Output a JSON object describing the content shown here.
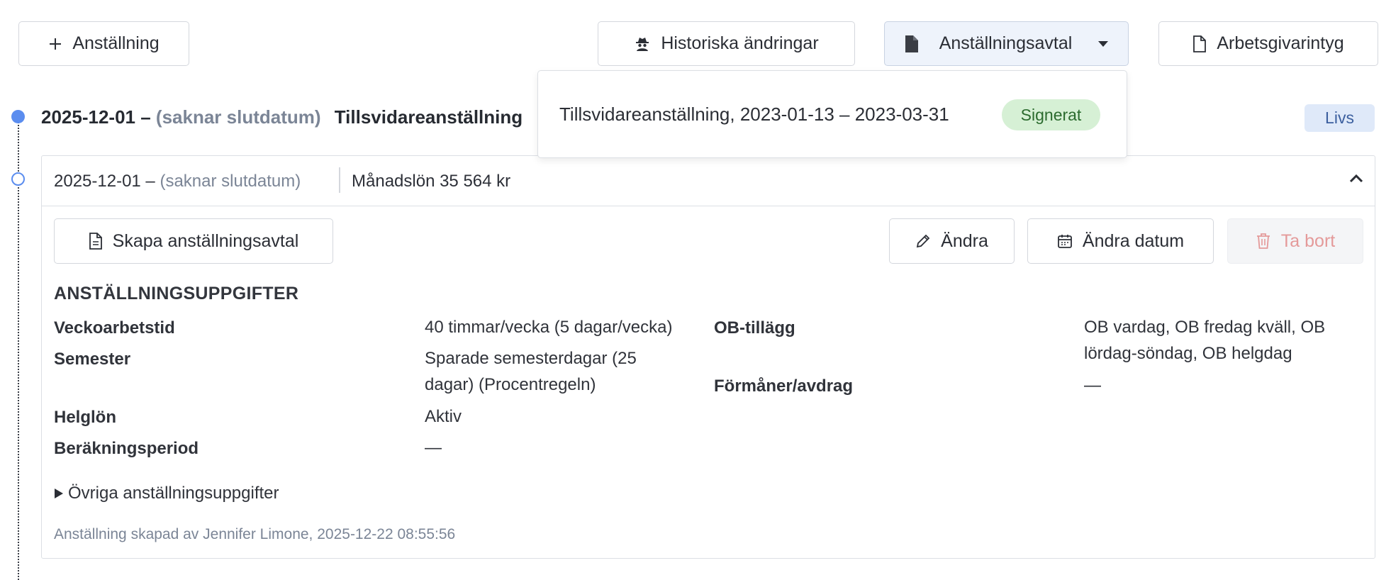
{
  "toolbar": {
    "add_employment": "Anställning",
    "history": "Historiska ändringar",
    "contract": "Anställningsavtal",
    "certificate": "Arbetsgivarintyg"
  },
  "employment": {
    "start": "2025-12-01 –",
    "end": "(saknar slutdatum)",
    "type": "Tillsvidareanställning",
    "badge": "Livs"
  },
  "dropdown": {
    "item": "Tillsvidareanställning, 2023-01-13 – 2023-03-31",
    "status": "Signerat"
  },
  "period": {
    "start": "2025-12-01 –",
    "end": "(saknar slutdatum)",
    "salary": "Månadslön 35 564 kr",
    "actions": {
      "create_contract": "Skapa anställningsavtal",
      "edit": "Ändra",
      "edit_date": "Ändra datum",
      "delete": "Ta bort"
    },
    "section_title": "ANSTÄLLNINGSUPPGIFTER",
    "fields": {
      "weekly_hours_label": "Veckoarbetstid",
      "weekly_hours_value": "40 timmar/vecka (5 dagar/vecka)",
      "vacation_label": "Semester",
      "vacation_value": "Sparade semesterdagar (25 dagar) (Procentregeln)",
      "holiday_pay_label": "Helglön",
      "holiday_pay_value": "Aktiv",
      "calc_period_label": "Beräkningsperiod",
      "calc_period_value": "—",
      "ob_label": "OB-tillägg",
      "ob_value": "OB vardag, OB fredag kväll, OB lördag-söndag, OB helgdag",
      "benefits_label": "Förmåner/avdrag",
      "benefits_value": "—"
    },
    "more": "Övriga anställningsuppgifter",
    "created_note": "Anställning skapad av Jennifer Limone, 2025-12-22 08:55:56"
  },
  "icons": {
    "plus": "plus-icon",
    "history": "spy-icon",
    "contract": "file-icon",
    "caret": "caret-down-icon",
    "certificate": "file-outline-icon",
    "chevron": "chevron-up-icon",
    "doc": "doc-lines-icon",
    "pencil": "pencil-icon",
    "calendar": "calendar-icon",
    "trash": "trash-icon",
    "triangle": "triangle-right-icon"
  },
  "colors": {
    "accent": "#5b8def",
    "badge_bg": "#dfe9f9",
    "signed_bg": "#d6f0d5",
    "delete_text": "#e49a9a"
  }
}
